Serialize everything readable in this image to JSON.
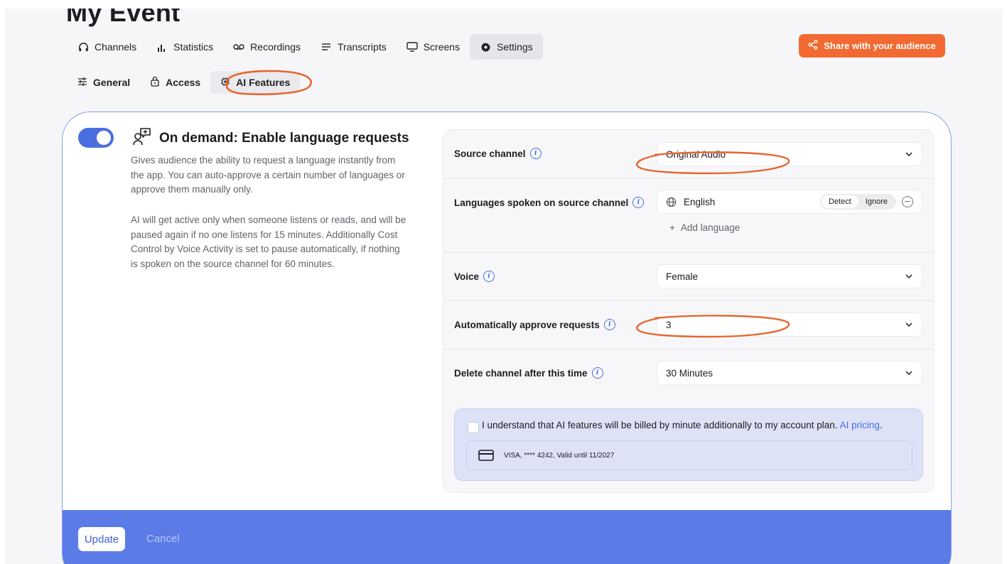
{
  "page_title": "My Event",
  "tabs": [
    {
      "label": "Channels",
      "icon": "headphones-icon"
    },
    {
      "label": "Statistics",
      "icon": "bar-chart-icon"
    },
    {
      "label": "Recordings",
      "icon": "voicemail-icon"
    },
    {
      "label": "Transcripts",
      "icon": "lines-icon"
    },
    {
      "label": "Screens",
      "icon": "monitor-icon"
    },
    {
      "label": "Settings",
      "icon": "gear-icon",
      "active": true
    }
  ],
  "share_button": {
    "label": "Share with your audience",
    "icon": "share-icon",
    "color": "#f26a32"
  },
  "subtabs": [
    {
      "label": "General",
      "icon": "sliders-icon"
    },
    {
      "label": "Access",
      "icon": "lock-icon"
    },
    {
      "label": "AI Features",
      "icon": "chip-icon",
      "active": true
    }
  ],
  "feature": {
    "enabled": true,
    "title": "On demand: Enable language requests",
    "description_1": "Gives audience the ability to request a language instantly from the app. You can auto-approve a certain number of languages or approve them manually only.",
    "description_2": "AI will get active only when someone listens or reads, and will be paused again if no one listens for 15 minutes. Additionally Cost Control by Voice Activity is set to pause automatically, if nothing is spoken on the source channel for 60 minutes."
  },
  "settings": {
    "source_channel": {
      "label": "Source channel",
      "value": "Original Audio"
    },
    "languages": {
      "label": "Languages spoken on source channel",
      "items": [
        {
          "name": "English",
          "mode_options": [
            "Detect",
            "Ignore"
          ],
          "mode_selected": "Detect"
        }
      ],
      "add_label": "Add language"
    },
    "voice": {
      "label": "Voice",
      "value": "Female"
    },
    "auto_approve": {
      "label": "Automatically approve requests",
      "value": "3"
    },
    "delete_after": {
      "label": "Delete channel after this time",
      "value": "30 Minutes"
    }
  },
  "billing": {
    "checked": false,
    "text": "I understand that AI features will be billed by minute additionally to my account plan.",
    "link": "AI pricing",
    "card": "VISA, **** 4242, Valid until 11/2027"
  },
  "footer": {
    "update_label": "Update",
    "cancel_label": "Cancel"
  },
  "colors": {
    "accent": "#4a6ee0",
    "footer": "#5b7be6",
    "annotation": "#e8652e"
  }
}
